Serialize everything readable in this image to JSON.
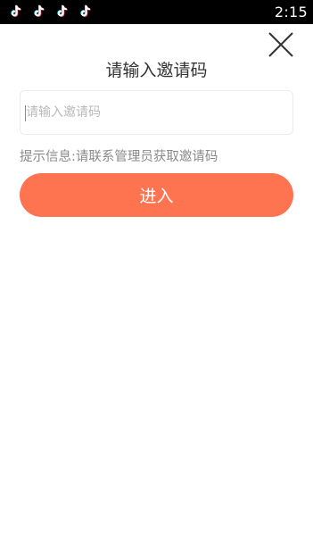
{
  "status_bar": {
    "time": "2:15",
    "notification_icons": [
      "tiktok-icon",
      "tiktok-icon",
      "tiktok-icon",
      "tiktok-icon"
    ]
  },
  "dialog": {
    "title": "请输入邀请码",
    "input": {
      "value": "",
      "placeholder": "请输入邀请码"
    },
    "hint": "提示信息:请联系管理员获取邀请码",
    "enter_label": "进入",
    "close_icon": "close-icon"
  },
  "colors": {
    "accent": "#fe7451",
    "status_bar_bg": "#000000",
    "title_text": "#333333",
    "hint_text": "#8a8a8a",
    "placeholder_text": "#b9b9b9"
  }
}
